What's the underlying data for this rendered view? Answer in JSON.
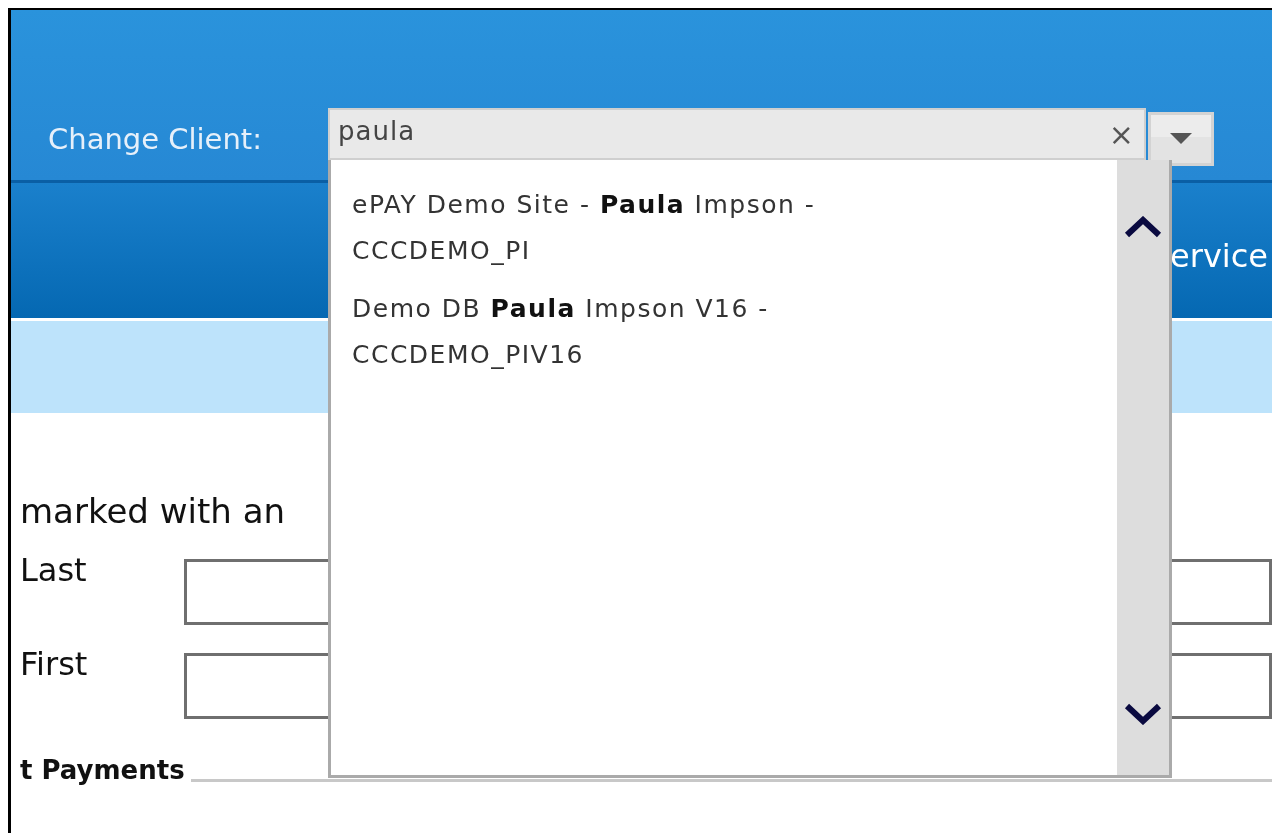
{
  "header": {
    "client_label": "Change Client:",
    "client_search": {
      "value": "paula",
      "clear": "×"
    }
  },
  "nav": {
    "item_partial": "ervice"
  },
  "content": {
    "instruction": "marked with an",
    "fields": [
      {
        "label": "Last"
      },
      {
        "label": "First"
      }
    ],
    "section_title": "t Payments"
  },
  "client_results": [
    {
      "text": "ePAY Demo Site - **Paula** Impson - CCCDEMO_PI"
    },
    {
      "text": "Demo DB **Paula** Impson V16 - CCCDEMO_PIV16"
    }
  ]
}
